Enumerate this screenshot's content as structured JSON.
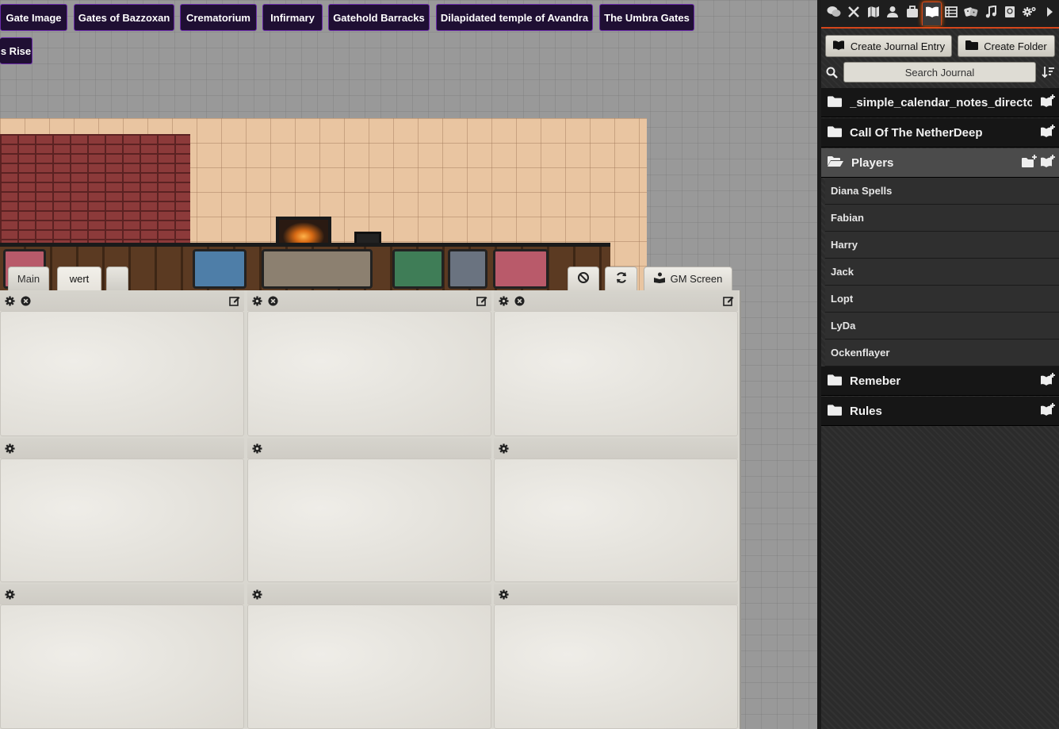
{
  "scene_nav": [
    "Gate Image",
    "Gates of Bazzoxan",
    "Crematorium",
    "Infirmary",
    "Gatehold Barracks",
    "Dilapidated temple of Avandra",
    "The Umbra Gates",
    "s Rise"
  ],
  "gm_screen": {
    "tabs": [
      "Main",
      "wert",
      ""
    ],
    "tools": {
      "screen_label": "GM Screen"
    }
  },
  "sidebar": {
    "create_entry": "Create Journal Entry",
    "create_folder": "Create Folder",
    "search_placeholder": "Search Journal",
    "folders": [
      "_simple_calendar_notes_directory",
      "Call Of The NetherDeep",
      "Players",
      "Remeber",
      "Rules"
    ],
    "player_entries": [
      "Diana Spells",
      "Fabian",
      "Harry",
      "Jack",
      "Lopt",
      "LyDa",
      "Ockenflayer"
    ]
  },
  "colors": {
    "scene_button_bg": "#1f0f33",
    "scene_button_border": "#6a2aa8",
    "active_tab_glow": "#d6461b"
  }
}
